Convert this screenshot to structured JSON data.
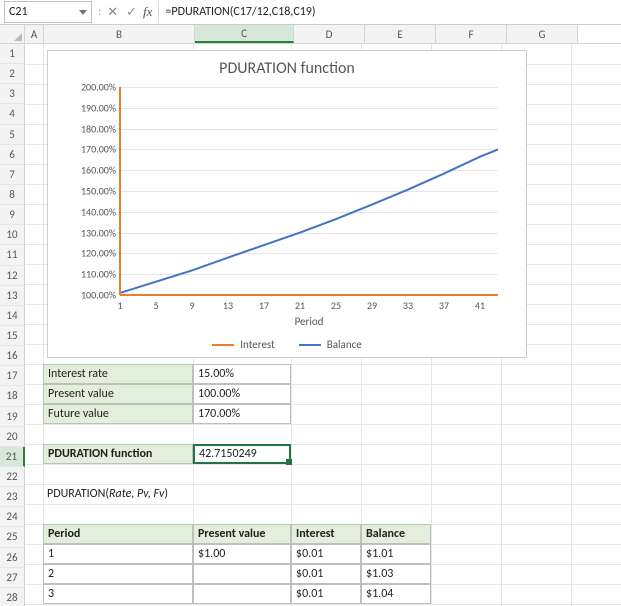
{
  "formula_bar": {
    "cell_ref": "C21",
    "formula": "=PDURATION(C17/12,C18,C19)"
  },
  "columns": [
    "A",
    "B",
    "C",
    "D",
    "E",
    "F",
    "G"
  ],
  "rows": [
    "1",
    "2",
    "3",
    "4",
    "5",
    "6",
    "7",
    "8",
    "9",
    "10",
    "11",
    "12",
    "13",
    "14",
    "15",
    "16",
    "17",
    "18",
    "19",
    "20",
    "21",
    "22",
    "23",
    "24",
    "25",
    "26",
    "27",
    "28"
  ],
  "active_row": "21",
  "chart": {
    "title": "PDURATION function",
    "xlabel": "Period",
    "yticks": [
      "100.00%",
      "110.00%",
      "120.00%",
      "130.00%",
      "140.00%",
      "150.00%",
      "160.00%",
      "170.00%",
      "180.00%",
      "190.00%",
      "200.00%"
    ],
    "xticks": [
      "1",
      "5",
      "9",
      "13",
      "17",
      "21",
      "25",
      "29",
      "33",
      "37",
      "41"
    ],
    "legend": {
      "s1": "Interest",
      "s2": "Balance"
    }
  },
  "chart_data": {
    "type": "line",
    "title": "PDURATION function",
    "xlabel": "Period",
    "ylabel": "",
    "ylim": [
      100,
      200
    ],
    "x": [
      1,
      5,
      9,
      13,
      17,
      21,
      25,
      29,
      33,
      37,
      41,
      43
    ],
    "series": [
      {
        "name": "Interest",
        "color": "#ed7d31",
        "values": [
          100,
          100,
          100,
          100,
          100,
          100,
          100,
          100,
          100,
          100,
          100,
          100
        ]
      },
      {
        "name": "Balance",
        "color": "#4472c4",
        "values": [
          101,
          106.4,
          111.8,
          118.0,
          124.0,
          130.0,
          136.5,
          143.5,
          150.7,
          158.4,
          166.5,
          170.0
        ]
      }
    ]
  },
  "inputs": {
    "r17_label": "Interest rate",
    "r17_value": "15.00%",
    "r18_label": "Present value",
    "r18_value": "100.00%",
    "r19_label": "Future value",
    "r19_value": "170.00%",
    "r21_label": "PDURATION function",
    "r21_value": "42.7150249"
  },
  "syntax": {
    "fn": "PDURATION(",
    "args": "Rate, Pv, Fv",
    "close": ")"
  },
  "table": {
    "headers": {
      "c1": "Period",
      "c2": "Present value",
      "c3": "Interest",
      "c4": "Balance"
    },
    "rows": [
      {
        "period": "1",
        "pv": "$1.00",
        "interest": "$0.01",
        "balance": "$1.01"
      },
      {
        "period": "2",
        "pv": "",
        "interest": "$0.01",
        "balance": "$1.03"
      },
      {
        "period": "3",
        "pv": "",
        "interest": "$0.01",
        "balance": "$1.04"
      }
    ]
  }
}
